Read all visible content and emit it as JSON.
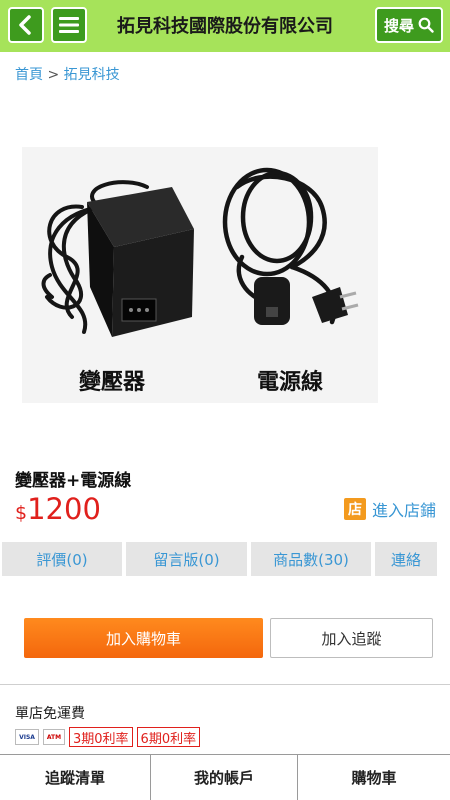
{
  "header": {
    "title": "拓見科技國際股份有限公司",
    "search_label": "搜尋",
    "colors": {
      "bar": "#a6e35a",
      "button": "#3e9b1e"
    }
  },
  "breadcrumb": {
    "home": "首頁",
    "separator": ">",
    "current": "拓見科技"
  },
  "product": {
    "image_captions": {
      "left": "變壓器",
      "right": "電源線"
    },
    "name": "變壓器+電源線",
    "currency": "$",
    "price": "1200",
    "price_color": "#e0201c"
  },
  "store_link": {
    "icon_text": "店",
    "label": "進入店鋪"
  },
  "tabs": [
    {
      "label": "評價(0)"
    },
    {
      "label": "留言版(0)"
    },
    {
      "label": "商品數(30)"
    },
    {
      "label": "連絡"
    }
  ],
  "actions": {
    "add_to_cart": "加入購物車",
    "add_to_track": "加入追蹤"
  },
  "shipping": {
    "free_ship": "單店免運費"
  },
  "payment": {
    "cards": [
      "VISA",
      "ATM"
    ],
    "installments": [
      "3期0利率",
      "6期0利率"
    ]
  },
  "bottom_nav": [
    {
      "label": "追蹤清單"
    },
    {
      "label": "我的帳戶"
    },
    {
      "label": "購物車"
    }
  ]
}
